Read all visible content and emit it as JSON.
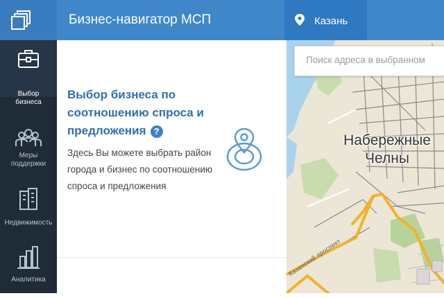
{
  "header": {
    "app_title": "Бизнес-навигатор МСП",
    "city": "Казань"
  },
  "sidebar": {
    "items": [
      {
        "label": "Выбор\nбизнеса",
        "icon": "briefcase-icon",
        "active": true
      },
      {
        "label": "Меры\nподдержки",
        "icon": "people-icon",
        "active": false
      },
      {
        "label": "Недвижимость",
        "icon": "buildings-icon",
        "active": false
      },
      {
        "label": "Аналитика",
        "icon": "bar-chart-icon",
        "active": false
      }
    ]
  },
  "panel": {
    "title": "Выбор бизнеса по соотношению спроса и предложения",
    "help": "?",
    "description": "Здесь Вы можете выбрать район города и бизнес по соотношению спроса и предложения"
  },
  "map": {
    "search_placeholder": "Поиск адреса в выбранном",
    "city_label": "Набережные Челны",
    "street_label": "Казанский проспект"
  },
  "colors": {
    "header": "#3f87c9",
    "sidebar": "#1f2b36",
    "accent_text": "#2f6fb0",
    "road_orange": "#f2b227",
    "water": "#a9d3ec"
  }
}
